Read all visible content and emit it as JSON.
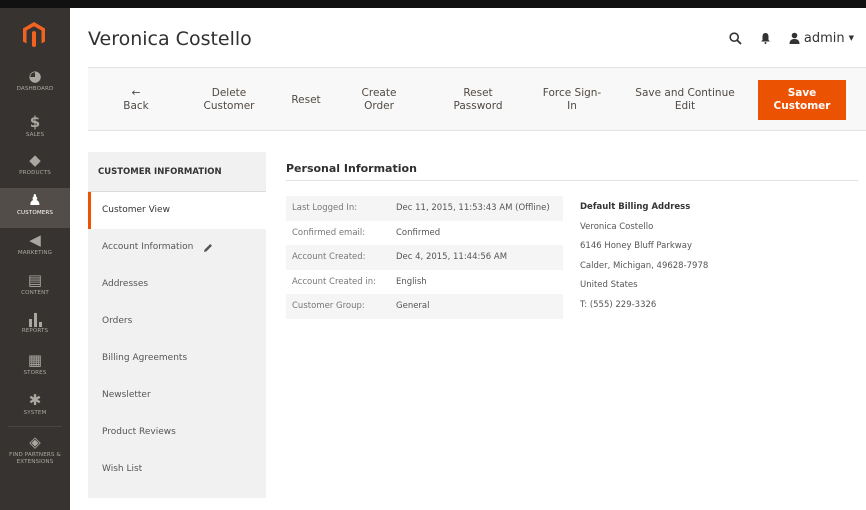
{
  "menu": {
    "items": [
      {
        "label": "Dashboard",
        "icon": "dashboard-icon",
        "glyph": "◕"
      },
      {
        "label": "Sales",
        "icon": "dollar-icon",
        "glyph": "$"
      },
      {
        "label": "Products",
        "icon": "cube-icon",
        "glyph": "◆"
      },
      {
        "label": "Customers",
        "icon": "person-icon",
        "glyph": "♟",
        "active": true
      },
      {
        "label": "Marketing",
        "icon": "megaphone-icon",
        "glyph": "◀"
      },
      {
        "label": "Content",
        "icon": "layout-icon",
        "glyph": "▤"
      },
      {
        "label": "Reports",
        "icon": "bar-chart-icon",
        "glyph": "▮"
      },
      {
        "label": "Stores",
        "icon": "store-icon",
        "glyph": "▦"
      },
      {
        "label": "System",
        "icon": "gear-icon",
        "glyph": "✱"
      },
      {
        "label": "Find Partners & Extensions",
        "icon": "box-icon",
        "glyph": "◈"
      }
    ]
  },
  "header": {
    "title": "Veronica Costello",
    "user": "admin"
  },
  "actions": {
    "back": [
      "←",
      "Back"
    ],
    "delete": [
      "Delete",
      "Customer"
    ],
    "reset": "Reset",
    "create_order": [
      "Create",
      "Order"
    ],
    "reset_password": [
      "Reset",
      "Password"
    ],
    "force_signin": [
      "Force Sign-",
      "In"
    ],
    "save_continue": [
      "Save and Continue",
      "Edit"
    ],
    "save": [
      "Save",
      "Customer"
    ]
  },
  "tabs": {
    "title": "CUSTOMER INFORMATION",
    "items": [
      "Customer View",
      "Account Information",
      "Addresses",
      "Orders",
      "Billing Agreements",
      "Newsletter",
      "Product Reviews",
      "Wish List"
    ]
  },
  "personal": {
    "title": "Personal Information",
    "rows": [
      {
        "label": "Last Logged In:",
        "value": "Dec 11, 2015, 11:53:43 AM (Offline)"
      },
      {
        "label": "Confirmed email:",
        "value": "Confirmed"
      },
      {
        "label": "Account Created:",
        "value": "Dec 4, 2015, 11:44:56 AM"
      },
      {
        "label": "Account Created in:",
        "value": "English"
      },
      {
        "label": "Customer Group:",
        "value": "General"
      }
    ]
  },
  "billing": {
    "title": "Default Billing Address",
    "lines": [
      "Veronica Costello",
      "6146 Honey Bluff Parkway",
      "Calder, Michigan, 49628-7978",
      "United States",
      "T: (555) 229-3326"
    ]
  },
  "colors": {
    "menu_bg": "#373330",
    "accent": "#eb5202"
  }
}
